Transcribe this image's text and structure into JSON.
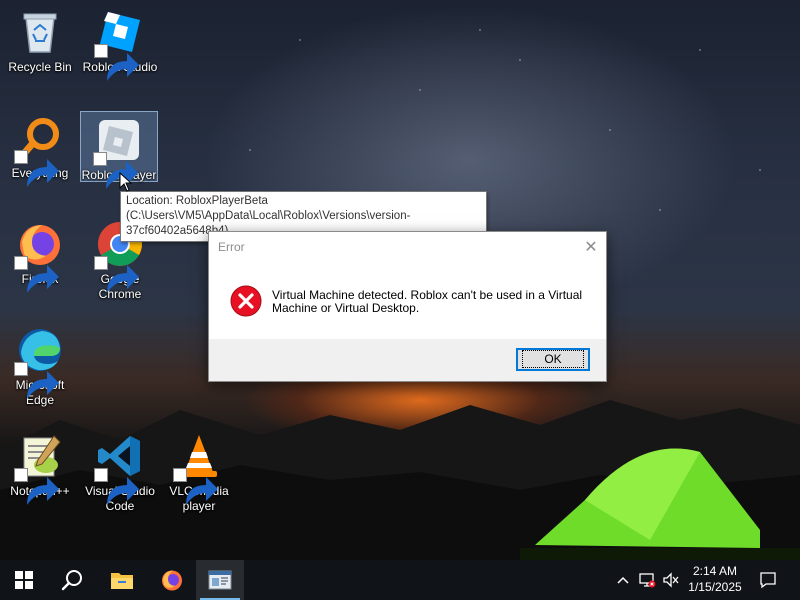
{
  "desktop": {
    "icons": [
      {
        "label": "Recycle Bin"
      },
      {
        "label": "Roblox Studio"
      },
      {
        "label": "Everything"
      },
      {
        "label": "Roblox Player"
      },
      {
        "label": "Firefox"
      },
      {
        "label": "Google Chrome"
      },
      {
        "label": "Microsoft Edge"
      },
      {
        "label": "Notepad++"
      },
      {
        "label": "Visual Studio Code"
      },
      {
        "label": "VLC media player"
      }
    ],
    "selected_icon": "Roblox Player"
  },
  "tooltip": {
    "text": "Location: RobloxPlayerBeta (C:\\Users\\VM5\\AppData\\Local\\Roblox\\Versions\\version-37cf60402a5648b4)"
  },
  "dialog": {
    "title": "Error",
    "close_glyph": "✕",
    "message": "Virtual Machine detected. Roblox can't be used in a Virtual Machine or Virtual Desktop.",
    "ok_label": "OK",
    "icon": "error-icon"
  },
  "taskbar": {
    "items": [
      "start-icon",
      "search-icon",
      "file-explorer-icon",
      "firefox-icon",
      "roblox-app-icon"
    ],
    "tray": {
      "chevron": "^",
      "icons": [
        "network-icon",
        "volume-muted-icon"
      ],
      "time": "2:14 AM",
      "date": "1/15/2025"
    }
  },
  "colors": {
    "accent": "#0078d7",
    "taskbar": "#101318",
    "error_red": "#e81123"
  }
}
